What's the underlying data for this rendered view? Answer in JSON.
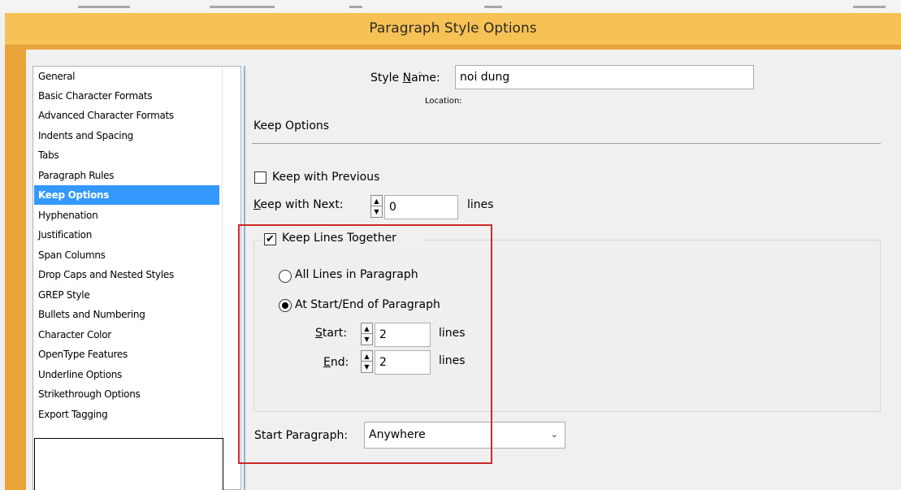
{
  "window": {
    "title": "Paragraph Style Options"
  },
  "sidebar": {
    "items": [
      {
        "label": "General"
      },
      {
        "label": "Basic Character Formats"
      },
      {
        "label": "Advanced Character Formats"
      },
      {
        "label": "Indents and Spacing"
      },
      {
        "label": "Tabs"
      },
      {
        "label": "Paragraph Rules"
      },
      {
        "label": "Keep Options",
        "selected": true
      },
      {
        "label": "Hyphenation"
      },
      {
        "label": "Justification"
      },
      {
        "label": "Span Columns"
      },
      {
        "label": "Drop Caps and Nested Styles"
      },
      {
        "label": "GREP Style"
      },
      {
        "label": "Bullets and Numbering"
      },
      {
        "label": "Character Color"
      },
      {
        "label": "OpenType Features"
      },
      {
        "label": "Underline Options"
      },
      {
        "label": "Strikethrough Options"
      },
      {
        "label": "Export Tagging"
      }
    ]
  },
  "form": {
    "style_name": {
      "label_pre": "Style ",
      "label_ul": "N",
      "label_post": "ame:",
      "value": "noi dung"
    },
    "location_label": "Location:",
    "section_title": "Keep Options",
    "keep_with_previous": {
      "label": "Keep with Previous",
      "checked": false
    },
    "keep_with_next": {
      "label_ul": "K",
      "label_post": "eep with Next:",
      "value": "0",
      "unit": "lines"
    },
    "keep_lines_together": {
      "label": "Keep Lines Together",
      "checked": true
    },
    "all_lines": {
      "label": "All Lines in Paragraph",
      "selected": false
    },
    "start_end": {
      "label": "At Start/End of Paragraph",
      "selected": true
    },
    "start": {
      "label_ul": "S",
      "label_post": "tart:",
      "value": "2",
      "unit": "lines"
    },
    "end": {
      "label_ul": "E",
      "label_post": "nd:",
      "value": "2",
      "unit": "lines"
    },
    "start_paragraph": {
      "label_pre": "Start Para",
      "label_ul": "g",
      "label_post": "raph:",
      "value": "Anywhere"
    }
  },
  "colors": {
    "titlebar": "#f6c256",
    "selection": "#3399ff",
    "highlight_box": "#cc2a2a"
  },
  "icons": {
    "check": "checkmark-icon",
    "spin_up": "spin-up-icon",
    "spin_down": "spin-down-icon",
    "dropdown": "chevron-down-icon",
    "scroll_up": "scroll-up-icon"
  }
}
